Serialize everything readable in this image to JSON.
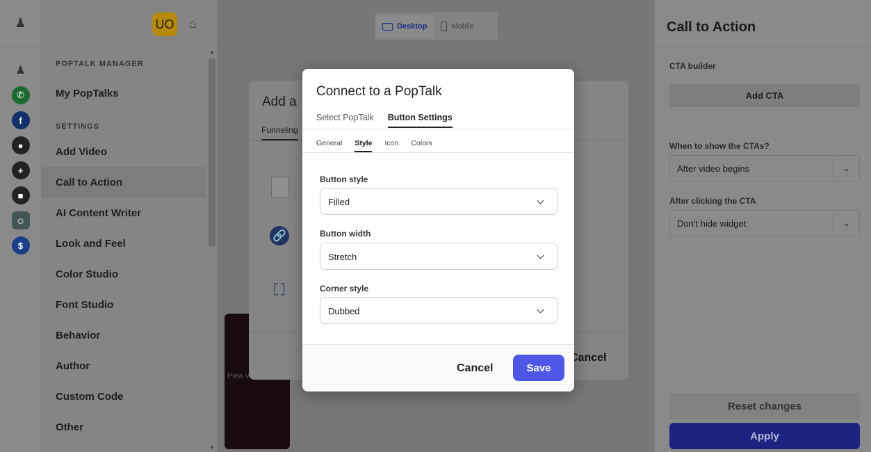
{
  "header": {
    "avatar_initials": "UO",
    "device_tabs": [
      {
        "label": "Desktop",
        "active": true
      },
      {
        "label": "Mobile",
        "active": false
      }
    ]
  },
  "rail": {
    "icons": [
      "logo-icon",
      "logo-icon",
      "whatsapp-icon",
      "facebook-icon",
      "contact-icon",
      "plus-icon",
      "square-icon",
      "mascot-icon",
      "dollar-icon"
    ]
  },
  "sidebar": {
    "section_manager": "POPTALK MANAGER",
    "my_poptalks": "My PopTalks",
    "section_settings": "SETTINGS",
    "items": [
      {
        "label": "Add Video"
      },
      {
        "label": "Call to Action",
        "active": true
      },
      {
        "label": "AI Content Writer"
      },
      {
        "label": "Look and Feel"
      },
      {
        "label": "Color Studio"
      },
      {
        "label": "Font Studio"
      },
      {
        "label": "Behavior"
      },
      {
        "label": "Author"
      },
      {
        "label": "Custom Code"
      },
      {
        "label": "Other"
      }
    ]
  },
  "background_modal": {
    "title": "Add a",
    "tab": "Funneling",
    "cancel_label": "Cancel"
  },
  "video_card": {
    "text": "Plea Video"
  },
  "right_panel": {
    "title": "Call to Action",
    "cta_builder_label": "CTA builder",
    "add_cta_label": "Add CTA",
    "when_label": "When to show the CTAs?",
    "when_value": "After video begins",
    "after_label": "After clicking the CTA",
    "after_value": "Don't hide widget",
    "reset_label": "Reset changes",
    "apply_label": "Apply"
  },
  "dialog": {
    "title": "Connect to a PopTalk",
    "tabs": [
      {
        "label": "Select PopTalk",
        "active": false
      },
      {
        "label": "Button Settings",
        "active": true
      }
    ],
    "subtabs": [
      {
        "label": "General",
        "active": false
      },
      {
        "label": "Style",
        "active": true
      },
      {
        "label": "Icon",
        "active": false
      },
      {
        "label": "Colors",
        "active": false
      }
    ],
    "fields": [
      {
        "label": "Button style",
        "value": "Filled"
      },
      {
        "label": "Button width",
        "value": "Stretch"
      },
      {
        "label": "Corner style",
        "value": "Dubbed"
      }
    ],
    "cancel_label": "Cancel",
    "save_label": "Save"
  },
  "colors": {
    "accent": "#4e57e6",
    "apply_bg": "#1e2382",
    "avatar_bg": "#f2b711"
  }
}
